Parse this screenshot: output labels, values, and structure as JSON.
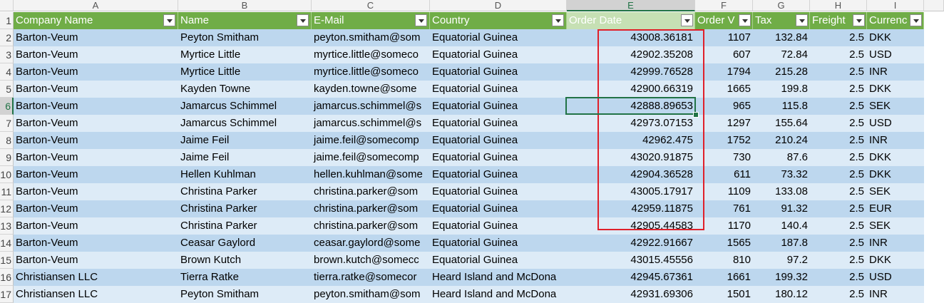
{
  "columns": [
    "A",
    "B",
    "C",
    "D",
    "E",
    "F",
    "G",
    "H",
    "I"
  ],
  "row_numbers": [
    "1",
    "2",
    "3",
    "4",
    "5",
    "6",
    "7",
    "8",
    "9",
    "10",
    "11",
    "12",
    "13",
    "14",
    "15",
    "16",
    "17"
  ],
  "table_headers": [
    "Company Name",
    "Name",
    "E-Mail",
    "Country",
    "Order Date",
    "Order V",
    "Tax",
    "Freight",
    "Currenc"
  ],
  "rows": [
    [
      "Barton-Veum",
      "Peyton Smitham",
      "peyton.smitham@som",
      "Equatorial Guinea",
      "43008.36181",
      "1107",
      "132.84",
      "2.5",
      "DKK"
    ],
    [
      "Barton-Veum",
      "Myrtice Little",
      "myrtice.little@someco",
      "Equatorial Guinea",
      "42902.35208",
      "607",
      "72.84",
      "2.5",
      "USD"
    ],
    [
      "Barton-Veum",
      "Myrtice Little",
      "myrtice.little@someco",
      "Equatorial Guinea",
      "42999.76528",
      "1794",
      "215.28",
      "2.5",
      "INR"
    ],
    [
      "Barton-Veum",
      "Kayden Towne",
      "kayden.towne@some",
      "Equatorial Guinea",
      "42900.66319",
      "1665",
      "199.8",
      "2.5",
      "DKK"
    ],
    [
      "Barton-Veum",
      "Jamarcus Schimmel",
      "jamarcus.schimmel@s",
      "Equatorial Guinea",
      "42888.89653",
      "965",
      "115.8",
      "2.5",
      "SEK"
    ],
    [
      "Barton-Veum",
      "Jamarcus Schimmel",
      "jamarcus.schimmel@s",
      "Equatorial Guinea",
      "42973.07153",
      "1297",
      "155.64",
      "2.5",
      "USD"
    ],
    [
      "Barton-Veum",
      "Jaime Feil",
      "jaime.feil@somecomp",
      "Equatorial Guinea",
      "42962.475",
      "1752",
      "210.24",
      "2.5",
      "INR"
    ],
    [
      "Barton-Veum",
      "Jaime Feil",
      "jaime.feil@somecomp",
      "Equatorial Guinea",
      "43020.91875",
      "730",
      "87.6",
      "2.5",
      "DKK"
    ],
    [
      "Barton-Veum",
      "Hellen Kuhlman",
      "hellen.kuhlman@some",
      "Equatorial Guinea",
      "42904.36528",
      "611",
      "73.32",
      "2.5",
      "DKK"
    ],
    [
      "Barton-Veum",
      "Christina Parker",
      "christina.parker@som",
      "Equatorial Guinea",
      "43005.17917",
      "1109",
      "133.08",
      "2.5",
      "SEK"
    ],
    [
      "Barton-Veum",
      "Christina Parker",
      "christina.parker@som",
      "Equatorial Guinea",
      "42959.11875",
      "761",
      "91.32",
      "2.5",
      "EUR"
    ],
    [
      "Barton-Veum",
      "Christina Parker",
      "christina.parker@som",
      "Equatorial Guinea",
      "42905.44583",
      "1170",
      "140.4",
      "2.5",
      "SEK"
    ],
    [
      "Barton-Veum",
      "Ceasar Gaylord",
      "ceasar.gaylord@some",
      "Equatorial Guinea",
      "42922.91667",
      "1565",
      "187.8",
      "2.5",
      "INR"
    ],
    [
      "Barton-Veum",
      "Brown Kutch",
      "brown.kutch@somecc",
      "Equatorial Guinea",
      "43015.45556",
      "810",
      "97.2",
      "2.5",
      "DKK"
    ],
    [
      "Christiansen LLC",
      "Tierra Ratke",
      "tierra.ratke@somecor",
      "Heard Island and McDona",
      "42945.67361",
      "1661",
      "199.32",
      "2.5",
      "USD"
    ],
    [
      "Christiansen LLC",
      "Peyton Smitham",
      "peyton.smitham@som",
      "Heard Island and McDona",
      "42931.69306",
      "1501",
      "180.12",
      "2.5",
      "INR"
    ]
  ],
  "selected_column": "E",
  "selected_row": "6",
  "colors": {
    "header_green": "#70ad47",
    "band_dark": "#bdd7ee",
    "band_light": "#ddebf7",
    "selection": "#217346",
    "highlight_box": "#e0202a"
  }
}
